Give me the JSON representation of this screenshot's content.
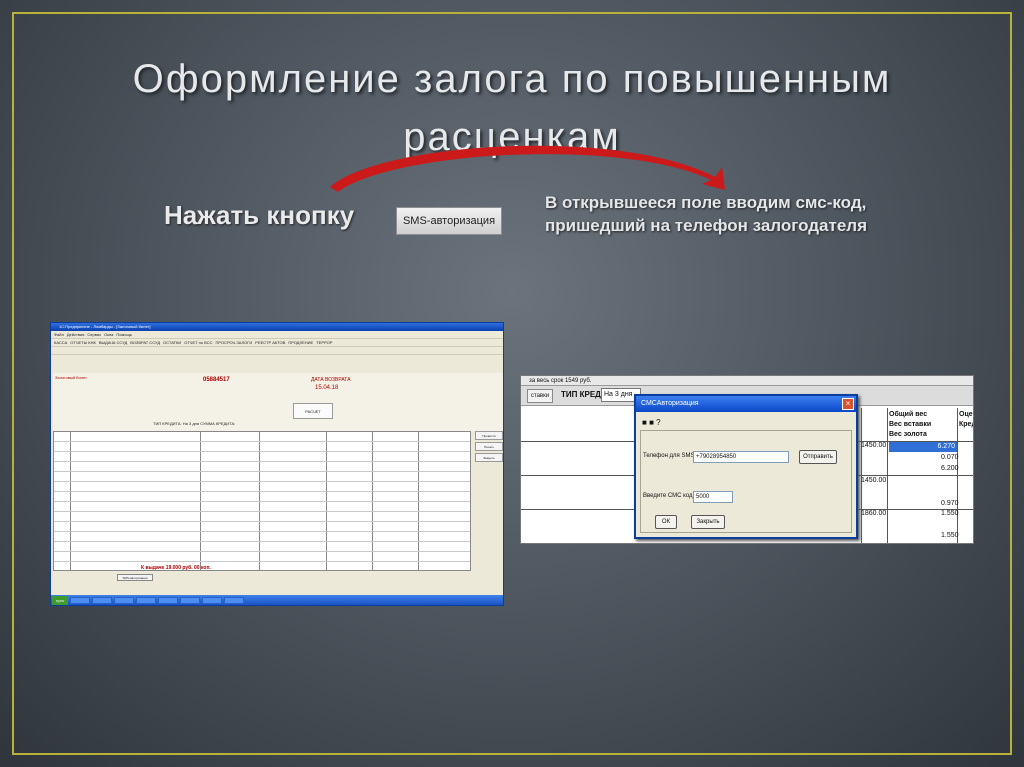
{
  "slide": {
    "title_line1": "Оформление залога по повышенным",
    "title_line2": "расценкам",
    "press_text": "Нажать кнопку",
    "sms_button_label": "SMS-авторизация",
    "note_line1": "В открывшееся поле вводим смс-код,",
    "note_line2": "пришедший на телефон залогодателя",
    "colors": {
      "frame": "#b9b23a",
      "arrow": "#cc1a1a",
      "background": "#4f5760"
    }
  },
  "left_window": {
    "title": "1С:Предприятие - Ломбарды - [Залоговый билет]",
    "menu": [
      "Файл",
      "Действия",
      "Сервис",
      "Окна",
      "Помощь"
    ],
    "toolbar": [
      "КАССА",
      "ОТЧЕТЫ КНК",
      "ВЫДАЧА ССУД",
      "ВОЗВРАТ ССУД",
      "ОСТАТКИ",
      "ОТЧЕТ по ВСС",
      "ПРОСРОЧ.ЗАЛОГИ",
      "РЕЕСТР АКТОВ",
      "ПРОДЛЕНИЕ",
      "ТЕРРОР"
    ],
    "form_title": "Залоговый билет",
    "doc_number": "05884517",
    "return_date_label": "ДАТА ВОЗВРАТА",
    "return_date": "15.04.18",
    "calc_button": "РАСЧЕТ",
    "credit_type_label": "ТИП КРЕДИТА:",
    "credit_type_value": "На 3 дня",
    "credit_sum_label": "СУММА КРЕДИТА:",
    "issue_text": "К выдаче 19.000 руб. 00 коп.",
    "sms_button": "SMS-авторизация",
    "side_buttons": [
      "Провести",
      "Печать",
      "Закрыть"
    ],
    "start_label": "пуск"
  },
  "right_window": {
    "top_strip": "за весь срок   1549 руб.",
    "stavki": "ставки",
    "credit_type_label": "ТИП КРЕДИТА:",
    "credit_type_value": "На 3 дня",
    "col_header": [
      "Общий вес",
      "Вес вставки",
      "Вес золота"
    ],
    "col2_header": [
      "Оцен",
      "Креди"
    ],
    "values": [
      "1450.00",
      "6.270",
      "0.070",
      "6.200",
      "1450.00",
      "0.970",
      "1860.00",
      "1.550",
      "1.550"
    ],
    "dialog": {
      "title": "СМСАвторизация",
      "phone_label": "Телефон для SMS",
      "phone_value": "+79028954850",
      "send_button": "Отправить",
      "code_label": "Введите СМС код",
      "code_value": "5000",
      "ok_button": "ОК",
      "close_button": "Закрыть"
    }
  }
}
